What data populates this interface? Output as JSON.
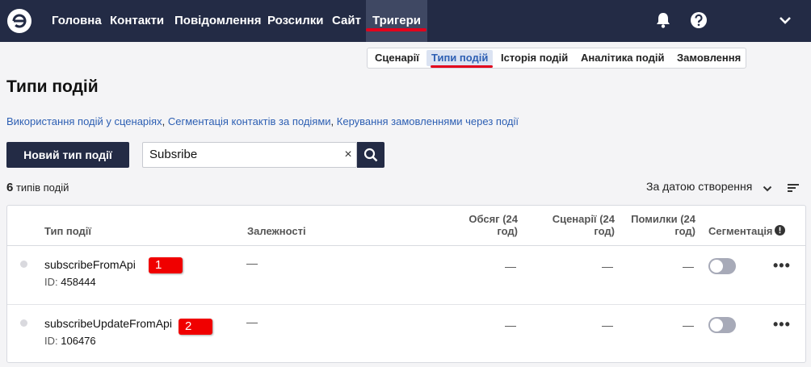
{
  "nav": {
    "items": [
      "Головна",
      "Контакти",
      "Повідомлення",
      "Розсилки",
      "Сайт",
      "Тригери"
    ],
    "active": "Тригери"
  },
  "subtabs": [
    "Сценарії",
    "Типи подій",
    "Історія подій",
    "Аналітика подій",
    "Замовлення"
  ],
  "page": {
    "title": "Типи подій",
    "links": [
      "Використання подій у сценаріях",
      "Сегментація контактів за подіями",
      "Керування замовленнями через події"
    ],
    "link_separator": ","
  },
  "actions": {
    "new_button": "Новий тип події",
    "search_value": "Subsribe",
    "clear_symbol": "×"
  },
  "summary": {
    "count": "6",
    "count_suffix": "типів подій",
    "sort_label": "За датою створення"
  },
  "table": {
    "headers": {
      "type": "Тип події",
      "deps": "Залежності",
      "volume_1": "Обсяг (24",
      "volume_2": "год)",
      "scen_1": "Сценарії (24",
      "scen_2": "год)",
      "err_1": "Помилки (24",
      "err_2": "год)",
      "seg": "Сегментація"
    },
    "rows": [
      {
        "name": "subscribeFromApi",
        "id_label": "ID:",
        "id": "458444",
        "deps": "—",
        "volume": "—",
        "scenarios": "—",
        "errors": "—",
        "badge": "1",
        "more": "•••"
      },
      {
        "name": "subscribeUpdateFromApi",
        "id_label": "ID:",
        "id": "106476",
        "deps": "—",
        "volume": "—",
        "scenarios": "—",
        "errors": "—",
        "badge": "2",
        "more": "•••"
      }
    ]
  },
  "colors": {
    "nav_bg": "#232b45",
    "accent_red": "#e3001b",
    "link_blue": "#2d5fb3"
  },
  "icons": [
    "logo-icon",
    "bell-icon",
    "help-icon",
    "chevron-down-icon",
    "search-icon",
    "close-icon",
    "info-icon",
    "sort-lines-icon"
  ]
}
